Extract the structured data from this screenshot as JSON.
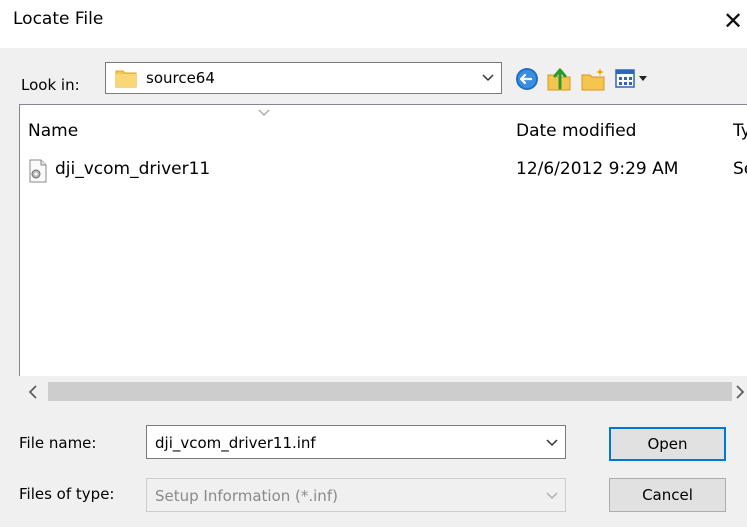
{
  "dialog": {
    "title": "Locate File",
    "close_symbol": "✕"
  },
  "toolbar": {
    "look_in_label": "Look in:",
    "look_in_value": "source64",
    "back_icon": "back-arrow-icon",
    "up_icon": "up-folder-icon",
    "new_folder_icon": "new-folder-icon",
    "view_icon": "view-menu-icon"
  },
  "file_list": {
    "columns": [
      {
        "label": "Name"
      },
      {
        "label": "Date modified"
      },
      {
        "label": "Ty"
      }
    ],
    "rows": [
      {
        "name": "dji_vcom_driver11",
        "date": "12/6/2012 9:29 AM",
        "type": "Se",
        "icon": "setup-file-icon"
      }
    ]
  },
  "footer": {
    "file_name_label": "File name:",
    "file_name_value": "dji_vcom_driver11.inf",
    "files_of_type_label": "Files of type:",
    "files_of_type_value": "Setup Information (*.inf)",
    "open_label": "Open",
    "cancel_label": "Cancel"
  },
  "colors": {
    "accent": "#0078d7",
    "panel_bg": "#f0f0f0",
    "folder": "#f4c64f"
  }
}
